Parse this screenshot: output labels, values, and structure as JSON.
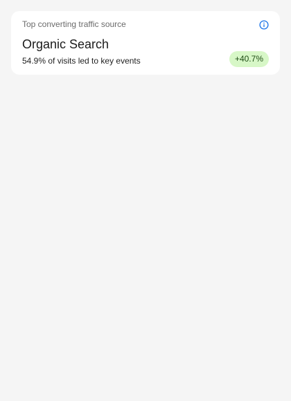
{
  "card": {
    "label": "Top converting traffic source",
    "info_icon": "info-icon",
    "source_name": "Organic Search",
    "detail": "54.9% of visits led to key events",
    "change": "+40.7%"
  },
  "colors": {
    "page_background": "#f5f5f5",
    "card_background": "#ffffff",
    "info_icon": "#1a73e8",
    "badge_background": "#d7f7c7",
    "badge_text": "#1f4d15"
  }
}
